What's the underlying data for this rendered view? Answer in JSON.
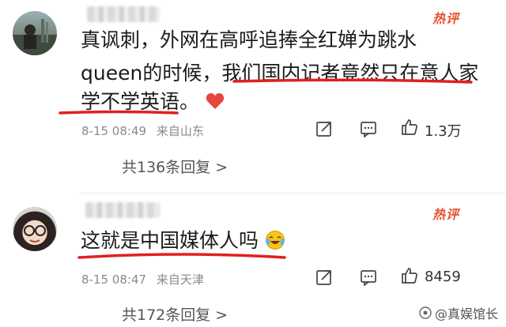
{
  "comments": [
    {
      "badge": "热评",
      "line1": "真讽刺，外网在高呼追捧全红婵为跳水",
      "line2": "queen的时候，我们国内记者竟然只在意人家",
      "line3": "学不学英语。",
      "date": "8-15 08:49",
      "location": "来自山东",
      "likes": "1.3万",
      "replies": "共136条回复 >"
    },
    {
      "badge": "热评",
      "line1": "这就是中国媒体人吗",
      "date": "8-15 08:47",
      "location": "来自天津",
      "likes": "8459",
      "replies": "共172条回复 >"
    }
  ],
  "watermark": "@真娱馆长",
  "colors": {
    "accent": "#e5532c",
    "underline": "#e02020",
    "heart": "#e8453c"
  },
  "icons": [
    "share-icon",
    "comment-icon",
    "like-icon",
    "heart-emoji",
    "laughing-crying-emoji"
  ]
}
